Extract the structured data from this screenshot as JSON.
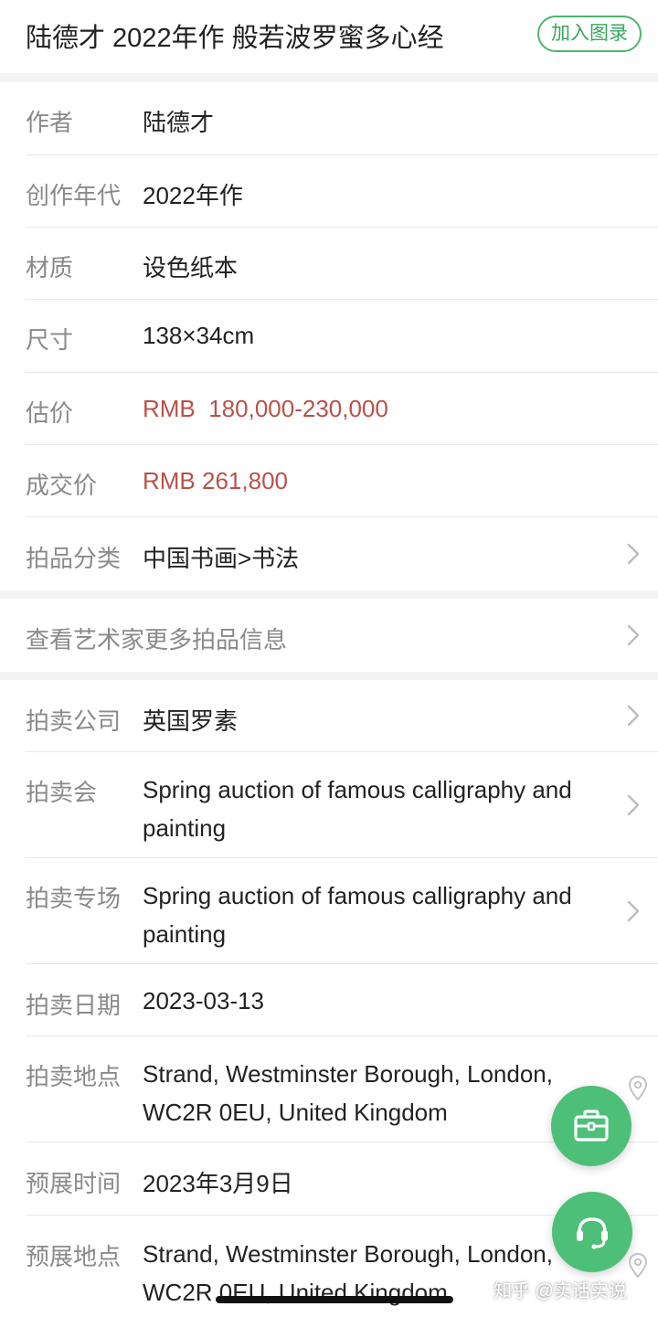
{
  "header": {
    "title": "陆德才 2022年作 般若波罗蜜多心经",
    "add_button": "加入图录"
  },
  "details": [
    {
      "label": "作者",
      "value": "陆德才"
    },
    {
      "label": "创作年代",
      "value": "2022年作"
    },
    {
      "label": "材质",
      "value": "设色纸本"
    },
    {
      "label": "尺寸",
      "value": "138×34cm"
    },
    {
      "label": "估价",
      "value": "RMB  180,000-230,000"
    },
    {
      "label": "成交价",
      "value": "RMB 261,800"
    },
    {
      "label": "拍品分类",
      "value": "中国书画>书法"
    }
  ],
  "artist_link": "查看艺术家更多拍品信息",
  "auction": [
    {
      "label": "拍卖公司",
      "value": "英国罗素"
    },
    {
      "label": "拍卖会",
      "value": "Spring auction of famous calligraphy and painting"
    },
    {
      "label": "拍卖专场",
      "value": "Spring auction of famous calligraphy and painting"
    },
    {
      "label": "拍卖日期",
      "value": "2023-03-13"
    },
    {
      "label": "拍卖地点",
      "value": "Strand, Westminster Borough, London, WC2R 0EU, United Kingdom"
    },
    {
      "label": "预展时间",
      "value": "2023年3月9日"
    },
    {
      "label": "预展地点",
      "value": "Strand, Westminster Borough, London, WC2R 0EU, United Kingdom"
    }
  ],
  "watermark": "知乎 @实话实说",
  "colors": {
    "accent_green": "#4ebf78",
    "price_red": "#b8514a",
    "label_gray": "#8a8a8a"
  },
  "icons": {
    "chevron": "chevron-right-icon",
    "location": "location-pin-icon",
    "briefcase": "briefcase-icon",
    "support": "headset-icon"
  }
}
